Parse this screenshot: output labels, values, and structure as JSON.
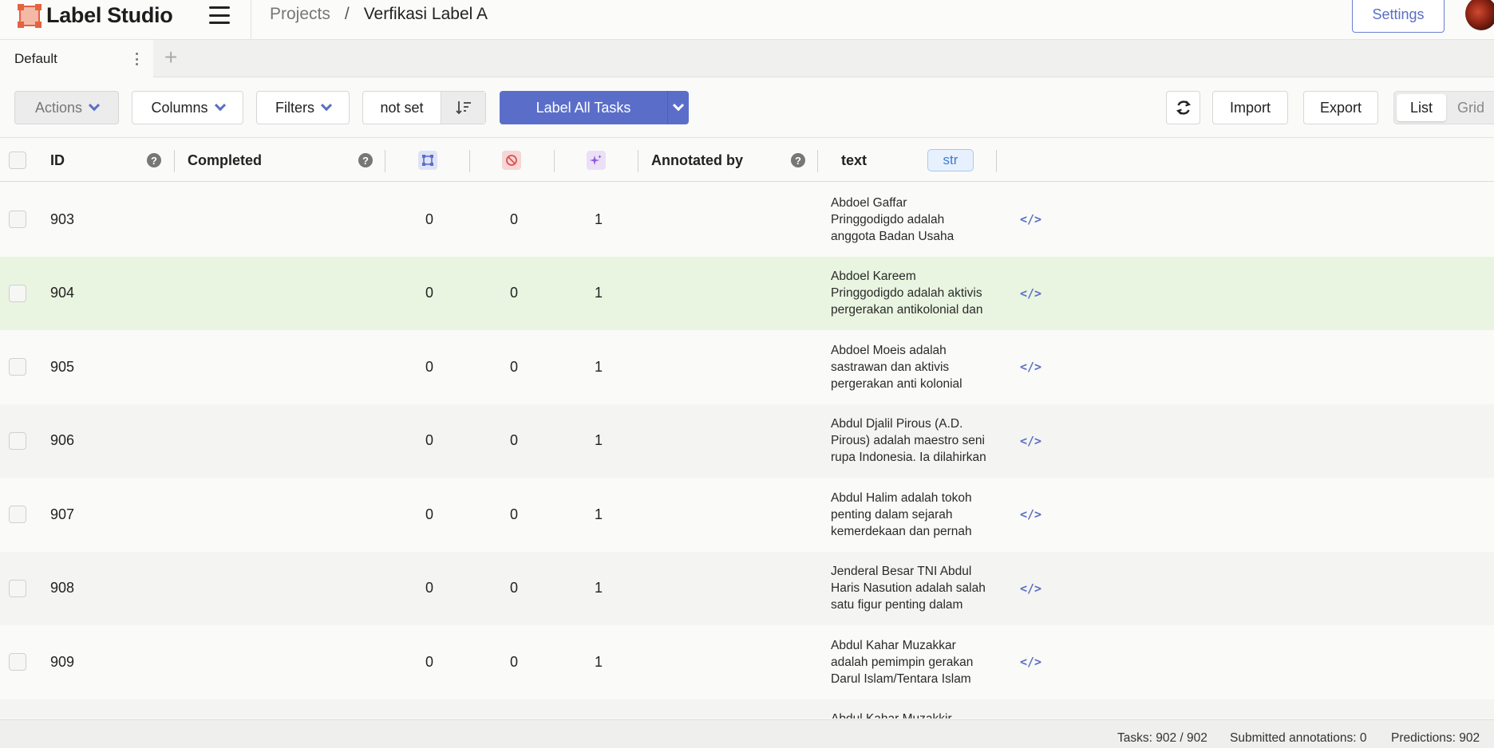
{
  "app": {
    "name": "Label Studio"
  },
  "breadcrumb": {
    "projects": "Projects",
    "separator": "/",
    "current": "Verfikasi Label A"
  },
  "header": {
    "settings_label": "Settings"
  },
  "tabs": {
    "default_label": "Default",
    "add_label": "+"
  },
  "toolbar": {
    "actions_label": "Actions",
    "columns_label": "Columns",
    "filters_label": "Filters",
    "sort_label": "not set",
    "label_all_label": "Label All Tasks",
    "import_label": "Import",
    "export_label": "Export",
    "view_list": "List",
    "view_grid": "Grid"
  },
  "columns": {
    "id": "ID",
    "completed": "Completed",
    "annotated_by": "Annotated by",
    "text": "text",
    "text_type": "str",
    "help": "?"
  },
  "rows": [
    {
      "id": "903",
      "total_annotations": "0",
      "cancelled": "0",
      "predictions": "1",
      "text_line1": "Abdoel Gaffar",
      "text_line2": "Pringgodigdo adalah",
      "text_line3": "anggota Badan Usaha",
      "highlight": false
    },
    {
      "id": "904",
      "total_annotations": "0",
      "cancelled": "0",
      "predictions": "1",
      "text_line1": "Abdoel Kareem",
      "text_line2": "Pringgodigdo adalah aktivis",
      "text_line3": "pergerakan antikolonial dan",
      "highlight": true
    },
    {
      "id": "905",
      "total_annotations": "0",
      "cancelled": "0",
      "predictions": "1",
      "text_line1": "Abdoel Moeis adalah",
      "text_line2": "sastrawan dan aktivis",
      "text_line3": "pergerakan anti kolonial",
      "highlight": false
    },
    {
      "id": "906",
      "total_annotations": "0",
      "cancelled": "0",
      "predictions": "1",
      "text_line1": "Abdul Djalil Pirous (A.D.",
      "text_line2": "Pirous) adalah maestro seni",
      "text_line3": "rupa Indonesia. Ia dilahirkan",
      "highlight": false
    },
    {
      "id": "907",
      "total_annotations": "0",
      "cancelled": "0",
      "predictions": "1",
      "text_line1": "Abdul Halim adalah tokoh",
      "text_line2": "penting dalam sejarah",
      "text_line3": "kemerdekaan dan pernah",
      "highlight": false
    },
    {
      "id": "908",
      "total_annotations": "0",
      "cancelled": "0",
      "predictions": "1",
      "text_line1": "Jenderal Besar TNI Abdul",
      "text_line2": "Haris Nasution adalah salah",
      "text_line3": "satu figur penting dalam",
      "highlight": false
    },
    {
      "id": "909",
      "total_annotations": "0",
      "cancelled": "0",
      "predictions": "1",
      "text_line1": "Abdul Kahar Muzakkar",
      "text_line2": "adalah pemimpin gerakan",
      "text_line3": "Darul Islam/Tentara Islam",
      "highlight": false
    },
    {
      "id": "",
      "total_annotations": "",
      "cancelled": "",
      "predictions": "",
      "text_line1": "Abdul Kahar Muzakkir",
      "text_line2": "",
      "text_line3": "",
      "highlight": false
    }
  ],
  "footer": {
    "tasks": "Tasks: 902 / 902",
    "submitted": "Submitted annotations: 0",
    "predictions": "Predictions: 902"
  },
  "colors": {
    "accent": "#5a6ec9",
    "highlight_row": "#e9f5e1",
    "str_badge": "#3e7ad6"
  }
}
